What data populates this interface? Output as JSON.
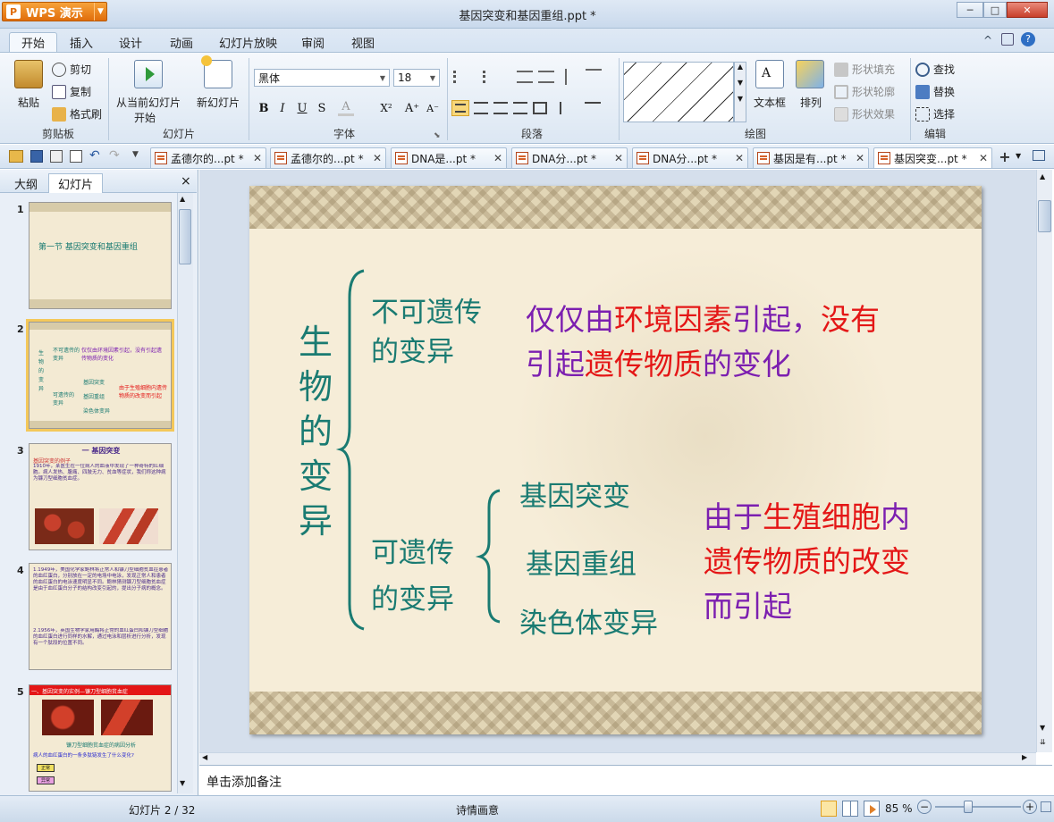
{
  "app": {
    "badge": "WPS 演示",
    "doc_title": "基因突变和基因重组.ppt *"
  },
  "window": {
    "minimize": "─",
    "maximize": "□",
    "close": "✕"
  },
  "ribbon_tabs": [
    "开始",
    "插入",
    "设计",
    "动画",
    "幻灯片放映",
    "审阅",
    "视图"
  ],
  "ribbon_right_icons": [
    "^",
    "shirt",
    "?"
  ],
  "clipboard": {
    "paste": "粘贴",
    "cut": "剪切",
    "copy": "复制",
    "format_painter": "格式刷",
    "group": "剪贴板"
  },
  "slides_group": {
    "from_current_l1": "从当前幻灯片",
    "from_current_l2": "开始",
    "new_slide": "新幻灯片",
    "group": "幻灯片"
  },
  "font": {
    "name": "黑体",
    "size": "18",
    "bold": "B",
    "italic": "I",
    "underline": "U",
    "shadow": "S",
    "color": "A",
    "superscript": "X²",
    "grow": "A⁺",
    "shrink": "A⁻",
    "group": "字体"
  },
  "paragraph": {
    "group": "段落"
  },
  "drawing": {
    "textbox": "文本框",
    "arrange": "排列",
    "shape_fill": "形状填充",
    "shape_outline": "形状轮廓",
    "shape_effect": "形状效果",
    "group": "绘图"
  },
  "editing": {
    "find": "查找",
    "replace": "替换",
    "select": "选择",
    "group": "编辑"
  },
  "doc_tabs": [
    {
      "label": "孟德尔的...pt *",
      "active": false
    },
    {
      "label": "孟德尔的...pt *",
      "active": false
    },
    {
      "label": "DNA是...pt *",
      "active": false
    },
    {
      "label": "DNA分...pt *",
      "active": false
    },
    {
      "label": "DNA分...pt *",
      "active": false
    },
    {
      "label": "基因是有...pt *",
      "active": false
    },
    {
      "label": "基因突变...pt *",
      "active": true
    }
  ],
  "doc_tab_add": "+",
  "left_panel": {
    "tab_outline": "大纲",
    "tab_slides": "幻灯片",
    "close": "×"
  },
  "thumbnails": [
    {
      "num": "1",
      "title": "第一节   基因突变和基因重组"
    },
    {
      "num": "2",
      "left_title": "生物的变异",
      "a": "不可遗传的变异",
      "b": "可遗传的变异",
      "c": "仅仅由环境因素引起，没有引起遗传物质的变化",
      "d1": "基因突变",
      "d2": "基因重组",
      "d3": "染色体变异",
      "e": "由于生殖细胞内遗传物质的改变而引起"
    },
    {
      "num": "3",
      "title": "一 基因突变",
      "sub": "基因突变的例子",
      "body": "1910年，某医生在一位病人的血液中发现了一种奇特的红细胞。病人发热、腹痛、四肢无力、贫血等症状，我们称这种病为镰刀型细胞贫血症。"
    },
    {
      "num": "4",
      "body1": "1.1949年，美国化学家鲍林将正常人和镰刀型细胞贫血症患者的血红蛋白，分别放在一定的电场中电泳，发现正常人和患者的血红蛋白的电泳速度明显不同。鲍林猜测镰刀型细胞贫血症是由于血红蛋白分子的结构改变引起的，提出分子病的概念。",
      "body2": "2.1956年，英国生物学家用酶将正常的血红蛋白和镰刀型细胞的血红蛋白进行同样的水解，通过电泳和层析进行分析，发现有一个肽段的位置不同。"
    },
    {
      "num": "5",
      "title": "一、基因突变的实例—镰刀型细胞贫血症",
      "caption": "镰刀型细胞贫血症的病因分析",
      "q": "病人的血红蛋白的一条多肽链发生了什么变化?",
      "r1": "正常",
      "r2": "异常"
    }
  ],
  "slide": {
    "left_title": [
      "生",
      "物",
      "的",
      "变",
      "异"
    ],
    "not_heritable_l1": "不可遗传",
    "not_heritable_l2": "的变异",
    "heritable_l1": "可遗传",
    "heritable_l2": "的变异",
    "desc1_parts": [
      {
        "t": "仅仅由",
        "c": "purple"
      },
      {
        "t": "环境因素",
        "c": "red"
      },
      {
        "t": "引起，",
        "c": "purple"
      },
      {
        "t": "没有",
        "c": "red"
      }
    ],
    "desc1b_parts": [
      {
        "t": "引起",
        "c": "purple"
      },
      {
        "t": "遗传物质",
        "c": "red"
      },
      {
        "t": "的变化",
        "c": "purple"
      }
    ],
    "gene_mutation": "基因突变",
    "gene_recomb": "基因重组",
    "chrom_variation": "染色体变异",
    "desc2a_parts": [
      {
        "t": "由于",
        "c": "purple"
      },
      {
        "t": "生殖细胞",
        "c": "red"
      },
      {
        "t": "内",
        "c": "purple"
      }
    ],
    "desc2b": "遗传物质的改变",
    "desc2c": "而引起"
  },
  "notes_placeholder": "单击添加备注",
  "status": {
    "slide_pos": "幻灯片 2 / 32",
    "theme": "诗情画意",
    "zoom": "85 %",
    "zoom_minus": "−",
    "zoom_plus": "+"
  },
  "colors": {
    "accent": "#1a7b72",
    "purple": "#7c1fb0",
    "red": "#e41616",
    "wps_orange": "#e8820f"
  }
}
